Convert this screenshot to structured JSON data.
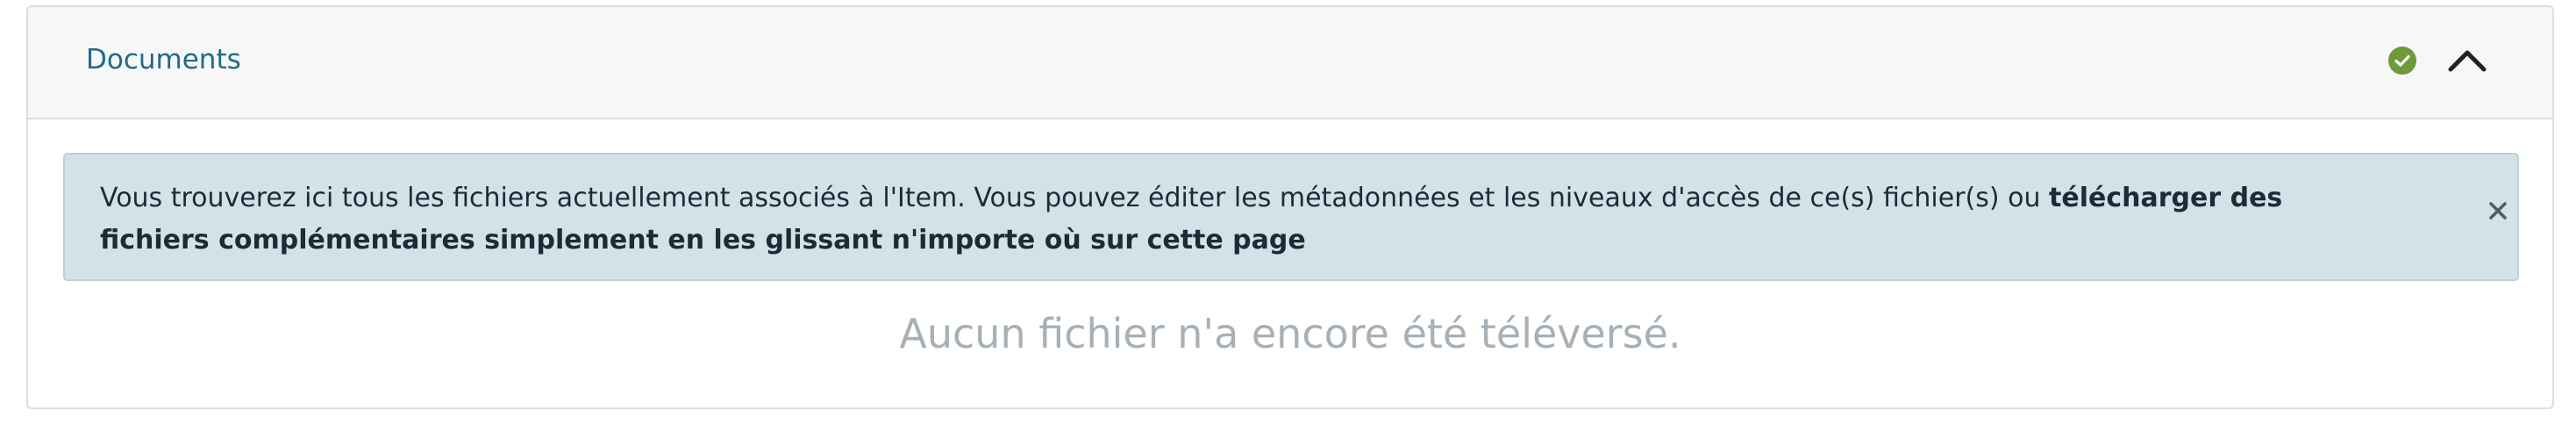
{
  "panel": {
    "title": "Documents",
    "status_icon": "check-circle-icon",
    "toggle_icon": "chevron-up-icon"
  },
  "alert": {
    "text_prefix": "Vous trouverez ici tous les fichiers actuellement associés à l'Item. Vous pouvez éditer les métadonnées et les niveaux d'accès de ce(s) fichier(s) ou ",
    "text_bold": "télécharger des fichiers complémentaires simplement en les glissant n'importe où sur cette page",
    "close_icon": "close-icon"
  },
  "empty_message": "Aucun fichier n'a encore été téléversé.",
  "colors": {
    "title": "#1f6b8a",
    "status_green": "#6f9a3c",
    "alert_bg": "#d4e2e8",
    "empty_text": "#a7b0b6"
  }
}
